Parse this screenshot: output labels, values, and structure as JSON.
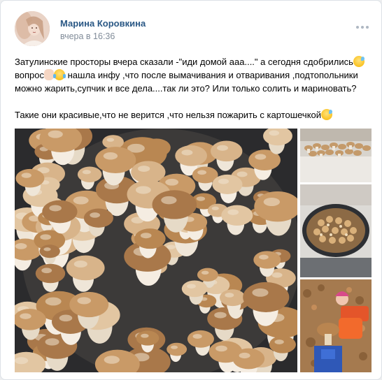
{
  "post": {
    "author": "Марина Коровкина",
    "date": "вчера в 16:36",
    "avatar_icon": "user-avatar",
    "more_icon": "more-horizontal-icon",
    "text": {
      "line1_part1": "Затулинские просторы вчера сказали -\"иди домой ааа....\" а сегодня сдобрились",
      "line2_part1": "вопрос",
      "line2_part2": " нашла инфу ,что после вымачивания и отваривания ,подтопольники",
      "line3": "можно жарить,супчик и все дела....так ли это? Или только солить и мариновать?",
      "line4": "Такие они красивые,что не верится ,что нельзя пожарить с картошечкой",
      "emojis": [
        "grinning-sweat-emoji",
        "raised-hand-emoji",
        "tears-of-joy-emoji",
        "grinning-sweat-emoji"
      ]
    },
    "photos": [
      {
        "name": "photo-main",
        "alt": "mushrooms-in-pan"
      },
      {
        "name": "photo-1",
        "alt": "mushrooms-on-table"
      },
      {
        "name": "photo-2",
        "alt": "mushrooms-in-pot"
      },
      {
        "name": "photo-3",
        "alt": "child-with-mushroom"
      }
    ],
    "colors": {
      "author": "#2a5885",
      "date": "#818c99",
      "text": "#000000",
      "background": "#ffffff"
    }
  }
}
